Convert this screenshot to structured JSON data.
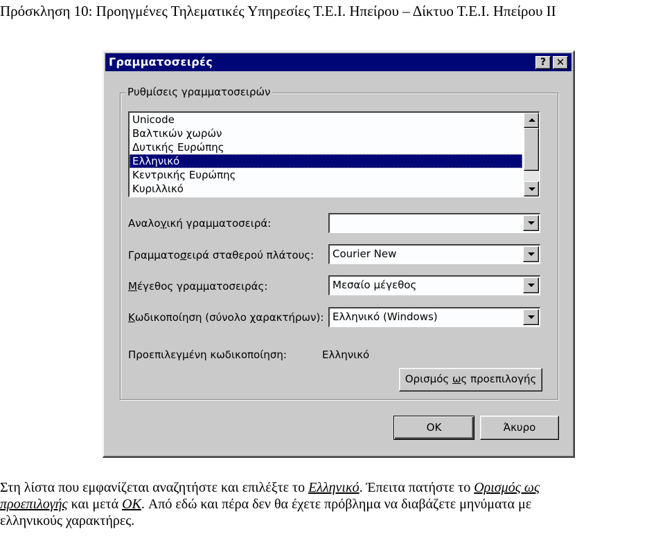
{
  "document": {
    "header": "Πρόσκληση 10: Προηγμένες Τηλεματικές Υπηρεσίες Τ.Ε.Ι. Ηπείρου – Δίκτυο Τ.Ε.Ι. Ηπείρου ΙΙ",
    "instructions": {
      "line1_pre": "Στη λίστα που εμφανίζεται αναζητήστε και επιλέξτε το ",
      "link_greek": "Ελληνικό",
      "line1_mid": ". Έπειτα πατήστε το ",
      "link_set_default_part1": "Ορισμός ως",
      "link_set_default_part2": "προεπιλογής",
      "line2_mid": " και μετά ",
      "link_ok": "OK",
      "line2_post": ". Από εδώ και πέρα δεν θα έχετε πρόβλημα να διαβάζετε μηνύματα με",
      "line3": "ελληνικούς χαρακτήρες."
    }
  },
  "dialog": {
    "title": "Γραμματοσειρές",
    "help_button": "?",
    "close_button": "✕",
    "group_title": "Ρυθμίσεις γραμματοσειρών",
    "charset_list": {
      "items": [
        "Unicode",
        "Βαλτικών χωρών",
        "Δυτικής Ευρώπης",
        "Ελληνικό",
        "Κεντρικής Ευρώπης",
        "Κυριλλικό"
      ],
      "selected": "Ελληνικό"
    },
    "fields": {
      "proportional_font": {
        "label_pre": "Αναλο",
        "label_accel": "γ",
        "label_post": "ική γραμματοσειρά:",
        "value": ""
      },
      "fixed_width_font": {
        "label_pre": "Γραμματο",
        "label_accel": "σ",
        "label_post": "ειρά σταθερού πλάτους:",
        "value": "Courier New"
      },
      "font_size": {
        "label_pre": "",
        "label_accel": "Μ",
        "label_post": "έγεθος γραμματοσειράς:",
        "value": "Μεσαίο μέγεθος"
      },
      "encoding": {
        "label_pre": "",
        "label_accel": "Κ",
        "label_post": "ωδικοποίηση (σύνολο χαρακτήρων):",
        "value": "Ελληνικό (Windows)"
      }
    },
    "default_encoding": {
      "label": "Προεπιλεγμένη κωδικοποίηση:",
      "value": "Ελληνικό"
    },
    "set_default_button": {
      "pre": "Ορισμός ",
      "accel": "ω",
      "post": "ς προεπιλογής"
    },
    "ok_button": "OK",
    "cancel_button": "Άκυρο"
  }
}
